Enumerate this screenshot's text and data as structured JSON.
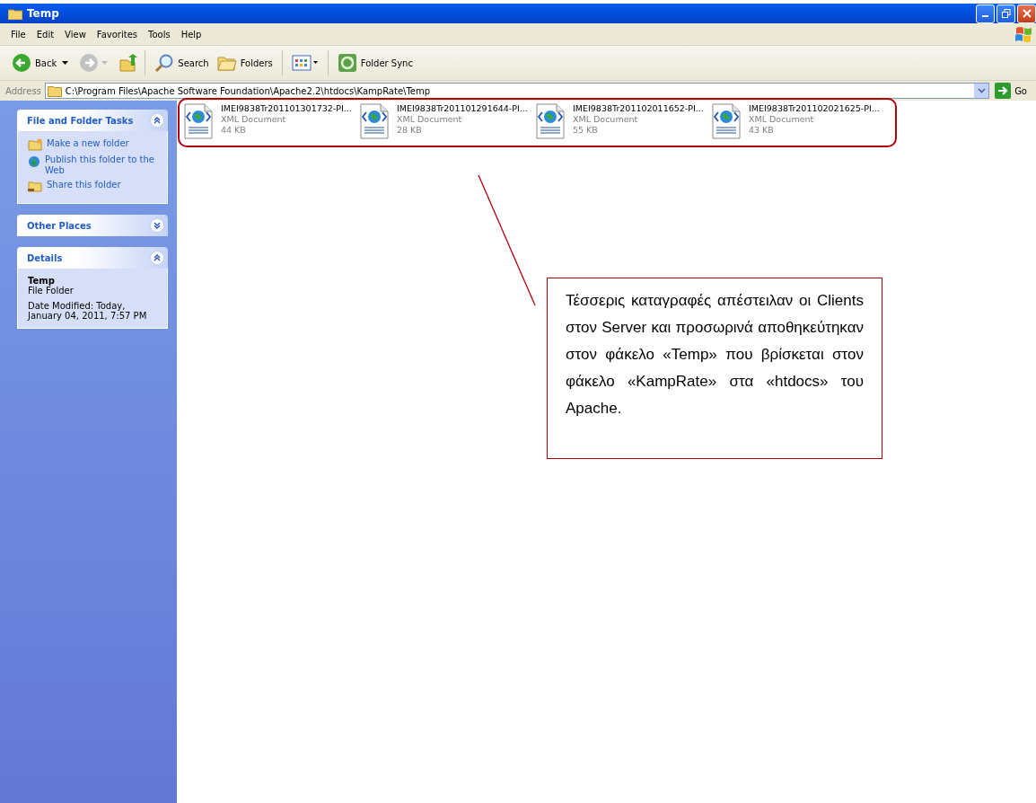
{
  "window": {
    "title": "Temp"
  },
  "menu": [
    "File",
    "Edit",
    "View",
    "Favorites",
    "Tools",
    "Help"
  ],
  "toolbar": {
    "back": "Back",
    "search": "Search",
    "folders": "Folders",
    "sync": "Folder Sync"
  },
  "address": {
    "label": "Address",
    "value": "C:\\Program Files\\Apache Software Foundation\\Apache2.2\\htdocs\\KampRate\\Temp",
    "go": "Go"
  },
  "panels": [
    {
      "kind": "tasks",
      "title": "File and Folder Tasks",
      "expanded": true,
      "items": [
        "Make a new folder",
        "Publish this folder to the Web",
        "Share this folder"
      ]
    },
    {
      "kind": "places",
      "title": "Other Places",
      "expanded": false
    },
    {
      "kind": "details",
      "title": "Details",
      "expanded": true,
      "name": "Temp",
      "type": "File Folder",
      "modified": "Date Modified: Today, January 04, 2011, 7:57 PM"
    }
  ],
  "files": [
    {
      "name": "IMEI9838Tr201101301732-PI...",
      "type": "XML Document",
      "size": "44 KB"
    },
    {
      "name": "IMEI9838Tr201101291644-PI...",
      "type": "XML Document",
      "size": "28 KB"
    },
    {
      "name": "IMEI9838Tr201102011652-PI...",
      "type": "XML Document",
      "size": "55 KB"
    },
    {
      "name": "IMEI9838Tr201102021625-PI...",
      "type": "XML Document",
      "size": "43 KB"
    }
  ],
  "callout": {
    "text": "Τέσσερις καταγραφές απέστειλαν οι Clients στον Server και προσωρινά αποθηκεύτηκαν στον φάκελο «Temp» που βρίσκεται στον φάκελο «KampRate» στα «htdocs» του Apache."
  }
}
